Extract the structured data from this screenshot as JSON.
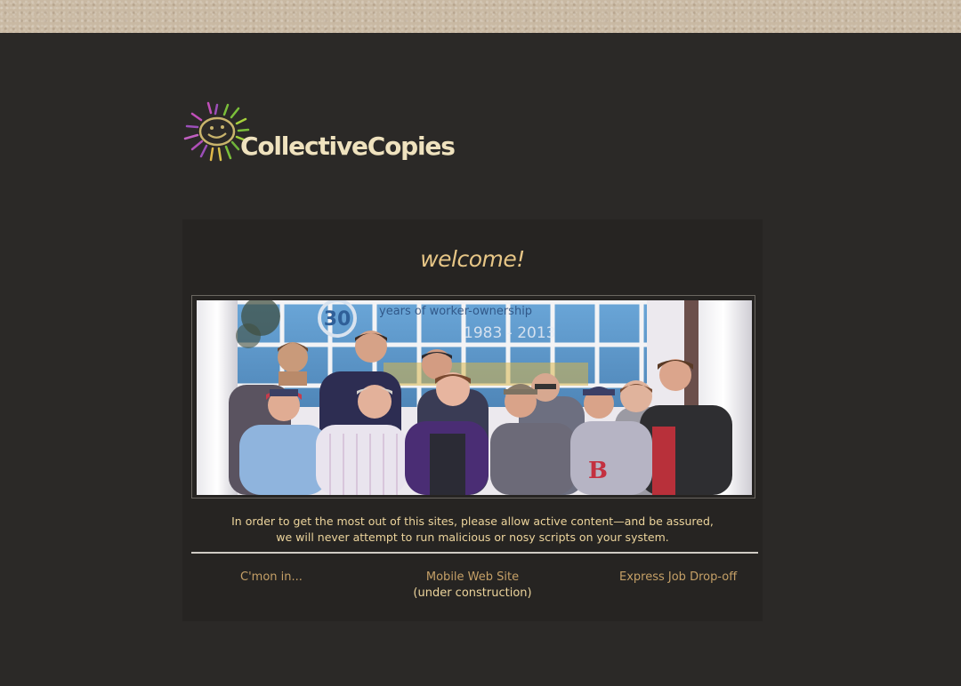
{
  "brand": {
    "name": "CollectiveCopies",
    "colors": {
      "page_bg": "#2b2927",
      "panel_bg": "#262422",
      "accent": "#e7c686",
      "link": "#c5a067",
      "text": "#ecd49c"
    }
  },
  "welcome": {
    "title": "welcome!"
  },
  "photo": {
    "sign_lines": [
      "30",
      "years of worker-ownership",
      "1983 - 2013"
    ]
  },
  "notice": {
    "line1": "In order to get the most out of this sites, please allow active content—and be assured,",
    "line2": "we will never attempt to run malicious or nosy scripts on your system."
  },
  "links": {
    "enter": "C'mon in...",
    "mobile": "Mobile Web Site",
    "mobile_note": "(under construction)",
    "express": "Express Job Drop-off"
  }
}
